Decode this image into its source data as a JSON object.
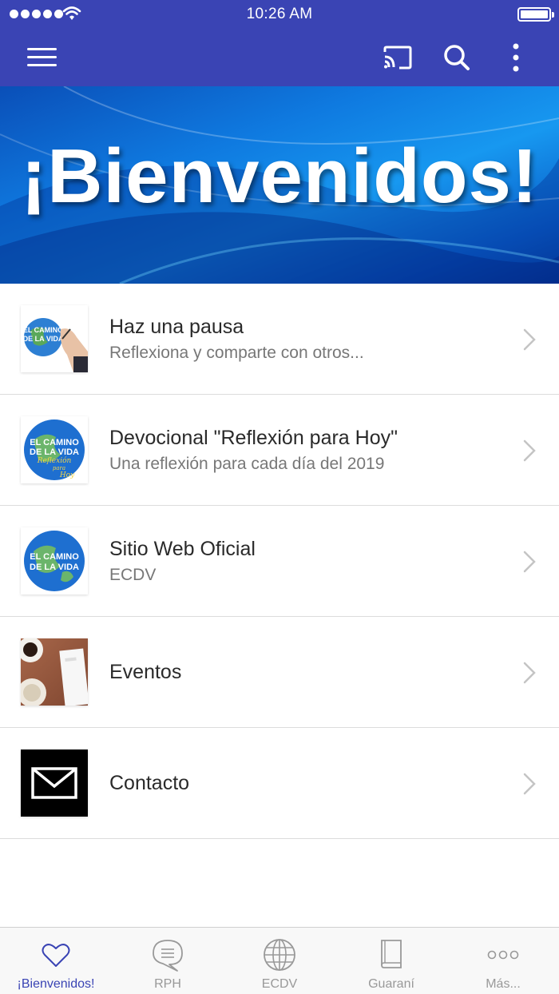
{
  "status_bar": {
    "time": "10:26 AM"
  },
  "nav_bar": {
    "icons": [
      "menu-icon",
      "cast-icon",
      "search-icon",
      "more-vertical-icon"
    ],
    "color": "#3a44b4"
  },
  "banner": {
    "title": "¡Bienvenidos!"
  },
  "list": {
    "items": [
      {
        "title": "Haz una pausa",
        "subtitle": "Reflexiona y comparte con otros..."
      },
      {
        "title": "Devocional \"Reflexión para Hoy\"",
        "subtitle": "Una reflexión para cada día del 2019"
      },
      {
        "title": "Sitio Web Oficial",
        "subtitle": "ECDV"
      },
      {
        "title": "Eventos",
        "subtitle": ""
      },
      {
        "title": "Contacto",
        "subtitle": ""
      }
    ],
    "logo_text": [
      "EL CAMINO",
      "DE LA VIDA"
    ],
    "logo_script": [
      "Reflexión",
      "para",
      "Hoy"
    ]
  },
  "tab_bar": {
    "tabs": [
      {
        "label": "¡Bienvenidos!",
        "icon": "heart-icon",
        "active": true
      },
      {
        "label": "RPH",
        "icon": "chat-bubble-icon",
        "active": false
      },
      {
        "label": "ECDV",
        "icon": "globe-icon",
        "active": false
      },
      {
        "label": "Guaraní",
        "icon": "book-icon",
        "active": false
      },
      {
        "label": "Más...",
        "icon": "more-dots-icon",
        "active": false
      }
    ],
    "active_color": "#3a44b4",
    "inactive_color": "#999999"
  }
}
